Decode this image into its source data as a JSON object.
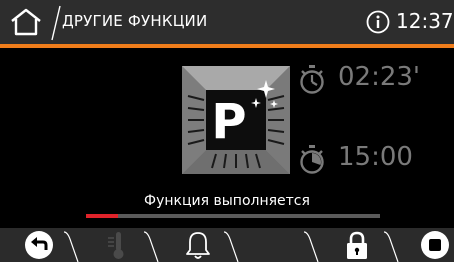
{
  "header": {
    "title": "ДРУГИЕ ФУНКЦИИ",
    "clock": "12:37"
  },
  "program": {
    "icon": "pyrolysis-cleaning-icon",
    "letter": "P"
  },
  "timers": {
    "duration": "02:23'",
    "end_time": "15:00"
  },
  "status": {
    "text": "Функция выполняется",
    "progress": 0.11
  },
  "footer": {
    "icons": [
      "back-icon",
      "thermometer-icon",
      "bell-icon",
      "lock-icon",
      "stop-icon"
    ]
  },
  "colors": {
    "accent": "#f07d1b",
    "progress": "#e0232a",
    "muted": "#7a7a7a"
  }
}
